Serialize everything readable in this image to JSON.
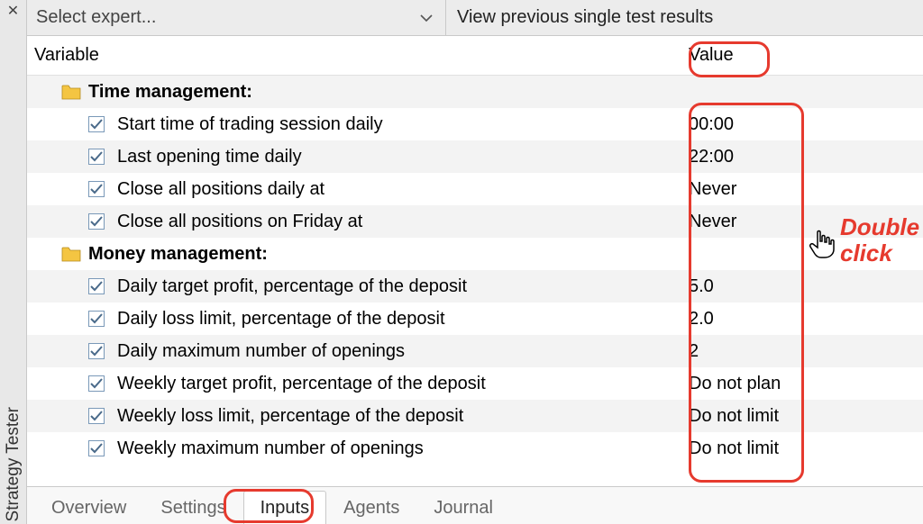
{
  "sidebar": {
    "title": "Strategy Tester"
  },
  "topbar": {
    "expert_placeholder": "Select expert...",
    "results_link": "View previous single test results"
  },
  "grid": {
    "headers": {
      "variable": "Variable",
      "value": "Value"
    },
    "groups": [
      {
        "label": "Time management:",
        "items": [
          {
            "label": "Start time of trading session daily",
            "value": "00:00",
            "checked": true
          },
          {
            "label": "Last opening time daily",
            "value": "22:00",
            "checked": true
          },
          {
            "label": "Close all positions daily at",
            "value": "Never",
            "checked": true
          },
          {
            "label": "Close all positions on Friday at",
            "value": "Never",
            "checked": true
          }
        ]
      },
      {
        "label": "Money management:",
        "items": [
          {
            "label": "Daily target profit, percentage of the deposit",
            "value": "5.0",
            "checked": true
          },
          {
            "label": "Daily loss limit, percentage of the deposit",
            "value": "2.0",
            "checked": true
          },
          {
            "label": "Daily maximum number of openings",
            "value": "2",
            "checked": true
          },
          {
            "label": "Weekly target profit, percentage of the deposit",
            "value": "Do not plan",
            "checked": true
          },
          {
            "label": "Weekly loss limit, percentage of the deposit",
            "value": "Do not limit",
            "checked": true
          },
          {
            "label": "Weekly maximum number of openings",
            "value": "Do not limit",
            "checked": true
          }
        ]
      }
    ]
  },
  "tabs": {
    "items": [
      "Overview",
      "Settings",
      "Inputs",
      "Agents",
      "Journal"
    ],
    "active_index": 2
  },
  "annotation": {
    "label_line1": "Double",
    "label_line2": "click"
  }
}
